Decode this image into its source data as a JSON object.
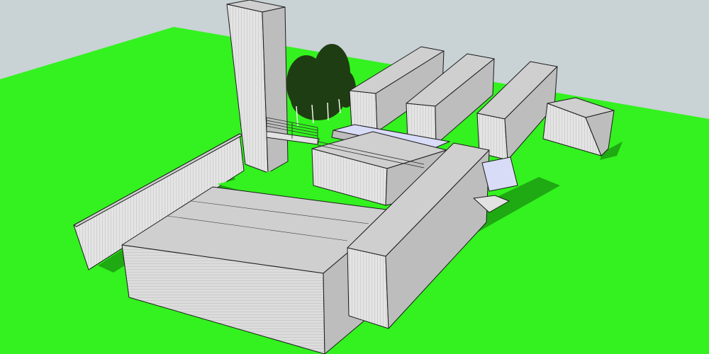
{
  "viewport": {
    "sky_color": "#c9d2d5",
    "ground_color": "#33f21f",
    "shadow_color": "#1fa912"
  },
  "model": {
    "wall_color": "#e2e2e2",
    "roof_color": "#cfcfcf",
    "side_color": "#bdbdbd",
    "glass_color": "#d9dcf7",
    "tree_color": "#1f3d12",
    "trunk_color": "#ffffff",
    "element_names": [
      "tower",
      "tree-cluster",
      "container-north-1",
      "container-north-2",
      "container-north-3",
      "annex-block",
      "bridge-walkway",
      "glass-deck",
      "courtyard",
      "boundary-wall-west",
      "main-block-south",
      "container-east-wing",
      "entrance-canopy"
    ]
  }
}
